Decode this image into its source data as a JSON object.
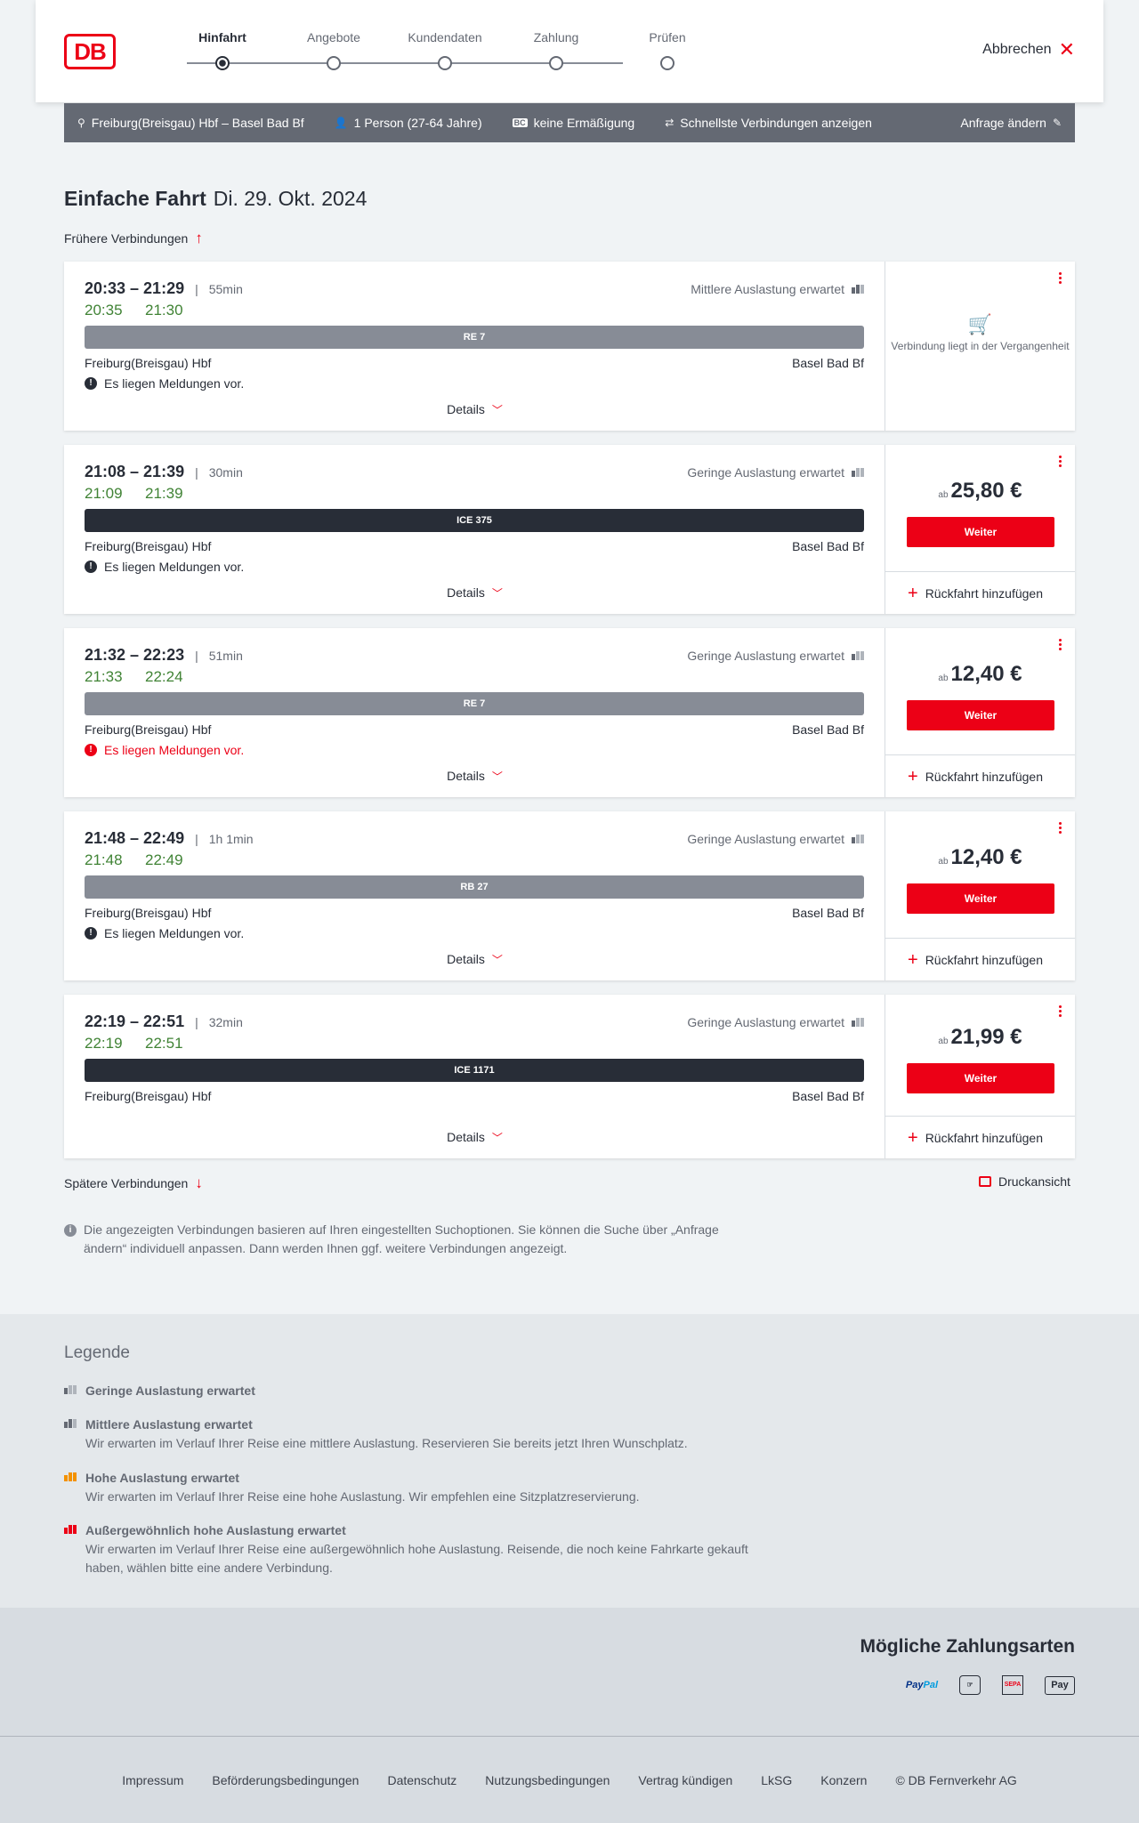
{
  "header": {
    "logo": "DB",
    "steps": [
      "Hinfahrt",
      "Angebote",
      "Kundendaten",
      "Zahlung",
      "Prüfen"
    ],
    "active_step": "Hinfahrt",
    "cancel_label": "Abbrechen"
  },
  "search": {
    "route": "Freiburg(Breisgau) Hbf – Basel Bad Bf",
    "travellers": "1 Person (27-64 Jahre)",
    "discount_badge": "BC",
    "discount": "keine Ermäßigung",
    "option": "Schnellste Verbindungen anzeigen",
    "change_label": "Anfrage ändern"
  },
  "page": {
    "title_bold": "Einfache Fahrt",
    "title_date": "Di. 29. Okt. 2024",
    "earlier_label": "Frühere Verbindungen",
    "later_label": "Spätere Verbindungen",
    "print_label": "Druckansicht",
    "info_text": "Die angezeigten Verbindungen basieren auf Ihren eingestellten Suchoptionen. Sie können die Suche über „Anfrage ändern“ individuell anpassen. Dann werden Ihnen ggf. weitere Verbindungen angezeigt.",
    "details_label": "Details",
    "weiter_label": "Weiter",
    "return_label": "Rückfahrt hinzufügen",
    "price_prefix": "ab",
    "past_label": "Verbindung liegt in der Vergangenheit"
  },
  "connections": [
    {
      "times": "20:33 – 21:29",
      "duration": "55min",
      "rt_dep": "20:35",
      "rt_arr": "21:30",
      "occupancy": "Mittlere Auslastung erwartet",
      "train": "RE 7",
      "from": "Freiburg(Breisgau) Hbf",
      "to": "Basel Bad Bf",
      "message": "Es liegen Meldungen vor.",
      "price": ""
    },
    {
      "times": "21:08 – 21:39",
      "duration": "30min",
      "rt_dep": "21:09",
      "rt_arr": "21:39",
      "occupancy": "Geringe Auslastung erwartet",
      "train": "ICE 375",
      "from": "Freiburg(Breisgau) Hbf",
      "to": "Basel Bad Bf",
      "message": "Es liegen Meldungen vor.",
      "price": "25,80 €"
    },
    {
      "times": "21:32 – 22:23",
      "duration": "51min",
      "rt_dep": "21:33",
      "rt_arr": "22:24",
      "occupancy": "Geringe Auslastung erwartet",
      "train": "RE 7",
      "from": "Freiburg(Breisgau) Hbf",
      "to": "Basel Bad Bf",
      "message": "Es liegen Meldungen vor.",
      "price": "12,40 €"
    },
    {
      "times": "21:48 – 22:49",
      "duration": "1h 1min",
      "rt_dep": "21:48",
      "rt_arr": "22:49",
      "occupancy": "Geringe Auslastung erwartet",
      "train": "RB 27",
      "from": "Freiburg(Breisgau) Hbf",
      "to": "Basel Bad Bf",
      "message": "Es liegen Meldungen vor.",
      "price": "12,40 €"
    },
    {
      "times": "22:19 – 22:51",
      "duration": "32min",
      "rt_dep": "22:19",
      "rt_arr": "22:51",
      "occupancy": "Geringe Auslastung erwartet",
      "train": "ICE 1171",
      "from": "Freiburg(Breisgau) Hbf",
      "to": "Basel Bad Bf",
      "message": "",
      "price": "21,99 €"
    }
  ],
  "legend": {
    "title": "Legende",
    "items": [
      {
        "title": "Geringe Auslastung erwartet",
        "text": ""
      },
      {
        "title": "Mittlere Auslastung erwartet",
        "text": "Wir erwarten im Verlauf Ihrer Reise eine mittlere Auslastung. Reservieren Sie bereits jetzt Ihren Wunschplatz."
      },
      {
        "title": "Hohe Auslastung erwartet",
        "text": "Wir erwarten im Verlauf Ihrer Reise eine hohe Auslastung. Wir empfehlen eine Sitzplatzreservierung."
      },
      {
        "title": "Außergewöhnlich hohe Auslastung erwartet",
        "text": "Wir erwarten im Verlauf Ihrer Reise eine außergewöhnlich hohe Auslastung. Reisende, die noch keine Fahrkarte gekauft haben, wählen bitte eine andere Verbindung."
      }
    ]
  },
  "payment": {
    "title": "Mögliche Zahlungsarten",
    "paypal_a": "Pay",
    "paypal_b": "Pal",
    "giro": "☞",
    "sepa": "SEPA",
    "applepay": "Pay"
  },
  "footer": [
    "Impressum",
    "Beförderungsbedingungen",
    "Datenschutz",
    "Nutzungsbedingungen",
    "Vertrag kündigen",
    "LkSG",
    "Konzern",
    "© DB Fernverkehr AG"
  ],
  "colors": {
    "brand": "#ec0016",
    "realtime": "#408335",
    "bar_regional": "#878c96",
    "bar_ice": "#282d37",
    "occ_high": "#f39200"
  }
}
